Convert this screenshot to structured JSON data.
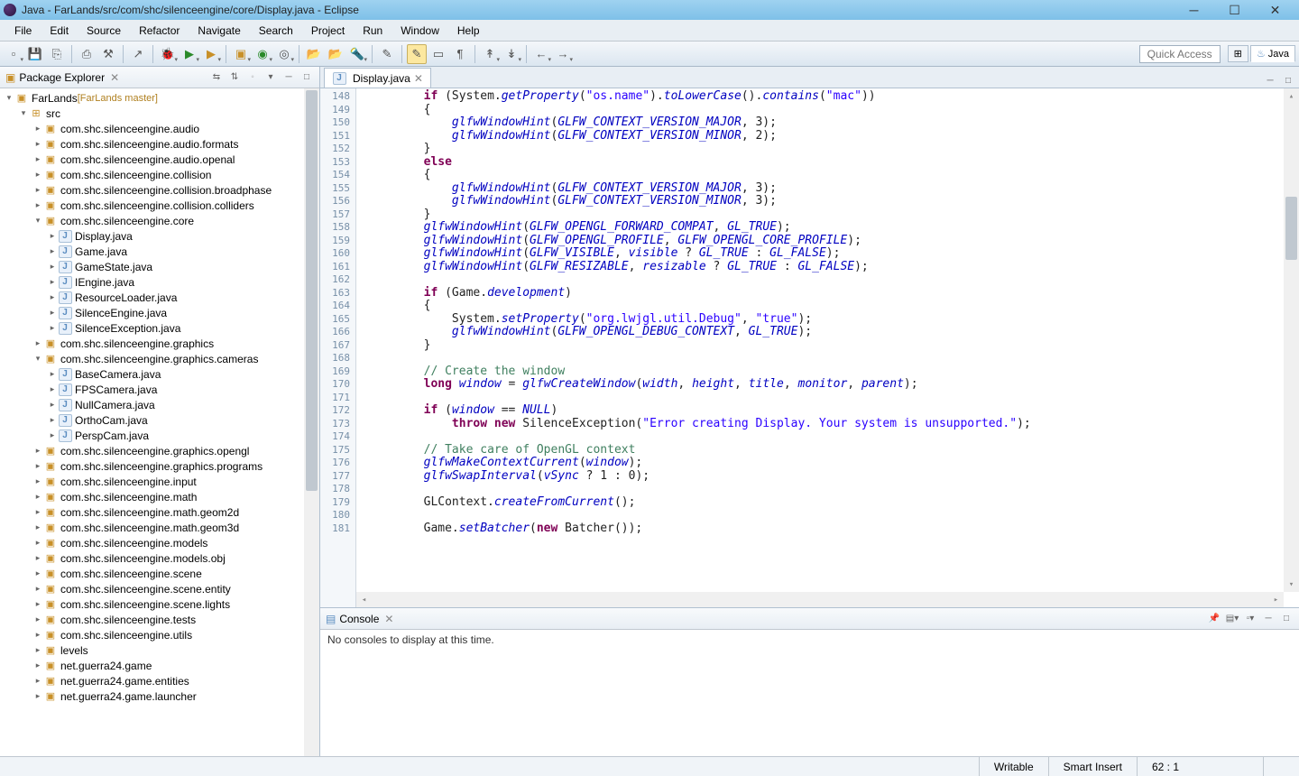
{
  "window": {
    "title": "Java - FarLands/src/com/shc/silenceengine/core/Display.java - Eclipse"
  },
  "menus": [
    "File",
    "Edit",
    "Source",
    "Refactor",
    "Navigate",
    "Search",
    "Project",
    "Run",
    "Window",
    "Help"
  ],
  "quick_access": "Quick Access",
  "perspective_label": "Java",
  "explorer": {
    "title": "Package Explorer",
    "project": "FarLands",
    "repo": "[FarLands master]",
    "src": "src",
    "packages_top": [
      "com.shc.silenceengine.audio",
      "com.shc.silenceengine.audio.formats",
      "com.shc.silenceengine.audio.openal",
      "com.shc.silenceengine.collision",
      "com.shc.silenceengine.collision.broadphase",
      "com.shc.silenceengine.collision.colliders"
    ],
    "core_pkg": "com.shc.silenceengine.core",
    "core_files": [
      "Display.java",
      "Game.java",
      "GameState.java",
      "IEngine.java",
      "ResourceLoader.java",
      "SilenceEngine.java",
      "SilenceException.java"
    ],
    "graphics_pkg": "com.shc.silenceengine.graphics",
    "cameras_pkg": "com.shc.silenceengine.graphics.cameras",
    "camera_files": [
      "BaseCamera.java",
      "FPSCamera.java",
      "NullCamera.java",
      "OrthoCam.java",
      "PerspCam.java"
    ],
    "packages_bottom": [
      "com.shc.silenceengine.graphics.opengl",
      "com.shc.silenceengine.graphics.programs",
      "com.shc.silenceengine.input",
      "com.shc.silenceengine.math",
      "com.shc.silenceengine.math.geom2d",
      "com.shc.silenceengine.math.geom3d",
      "com.shc.silenceengine.models",
      "com.shc.silenceengine.models.obj",
      "com.shc.silenceengine.scene",
      "com.shc.silenceengine.scene.entity",
      "com.shc.silenceengine.scene.lights",
      "com.shc.silenceengine.tests",
      "com.shc.silenceengine.utils",
      "levels",
      "net.guerra24.game",
      "net.guerra24.game.entities",
      "net.guerra24.game.launcher"
    ]
  },
  "editor": {
    "tab": "Display.java",
    "first_line": 148,
    "lines": [
      "        if (System.getProperty(\"os.name\").toLowerCase().contains(\"mac\"))",
      "        {",
      "            glfwWindowHint(GLFW_CONTEXT_VERSION_MAJOR, 3);",
      "            glfwWindowHint(GLFW_CONTEXT_VERSION_MINOR, 2);",
      "        }",
      "        else",
      "        {",
      "            glfwWindowHint(GLFW_CONTEXT_VERSION_MAJOR, 3);",
      "            glfwWindowHint(GLFW_CONTEXT_VERSION_MINOR, 3);",
      "        }",
      "        glfwWindowHint(GLFW_OPENGL_FORWARD_COMPAT, GL_TRUE);",
      "        glfwWindowHint(GLFW_OPENGL_PROFILE, GLFW_OPENGL_CORE_PROFILE);",
      "        glfwWindowHint(GLFW_VISIBLE, visible ? GL_TRUE : GL_FALSE);",
      "        glfwWindowHint(GLFW_RESIZABLE, resizable ? GL_TRUE : GL_FALSE);",
      "",
      "        if (Game.development)",
      "        {",
      "            System.setProperty(\"org.lwjgl.util.Debug\", \"true\");",
      "            glfwWindowHint(GLFW_OPENGL_DEBUG_CONTEXT, GL_TRUE);",
      "        }",
      "",
      "        // Create the window",
      "        long window = glfwCreateWindow(width, height, title, monitor, parent);",
      "",
      "        if (window == NULL)",
      "            throw new SilenceException(\"Error creating Display. Your system is unsupported.\");",
      "",
      "        // Take care of OpenGL context",
      "        glfwMakeContextCurrent(window);",
      "        glfwSwapInterval(vSync ? 1 : 0);",
      "",
      "        GLContext.createFromCurrent();",
      "",
      "        Game.setBatcher(new Batcher());"
    ]
  },
  "console": {
    "title": "Console",
    "empty_msg": "No consoles to display at this time."
  },
  "status": {
    "writable": "Writable",
    "insert": "Smart Insert",
    "pos": "62 : 1"
  }
}
